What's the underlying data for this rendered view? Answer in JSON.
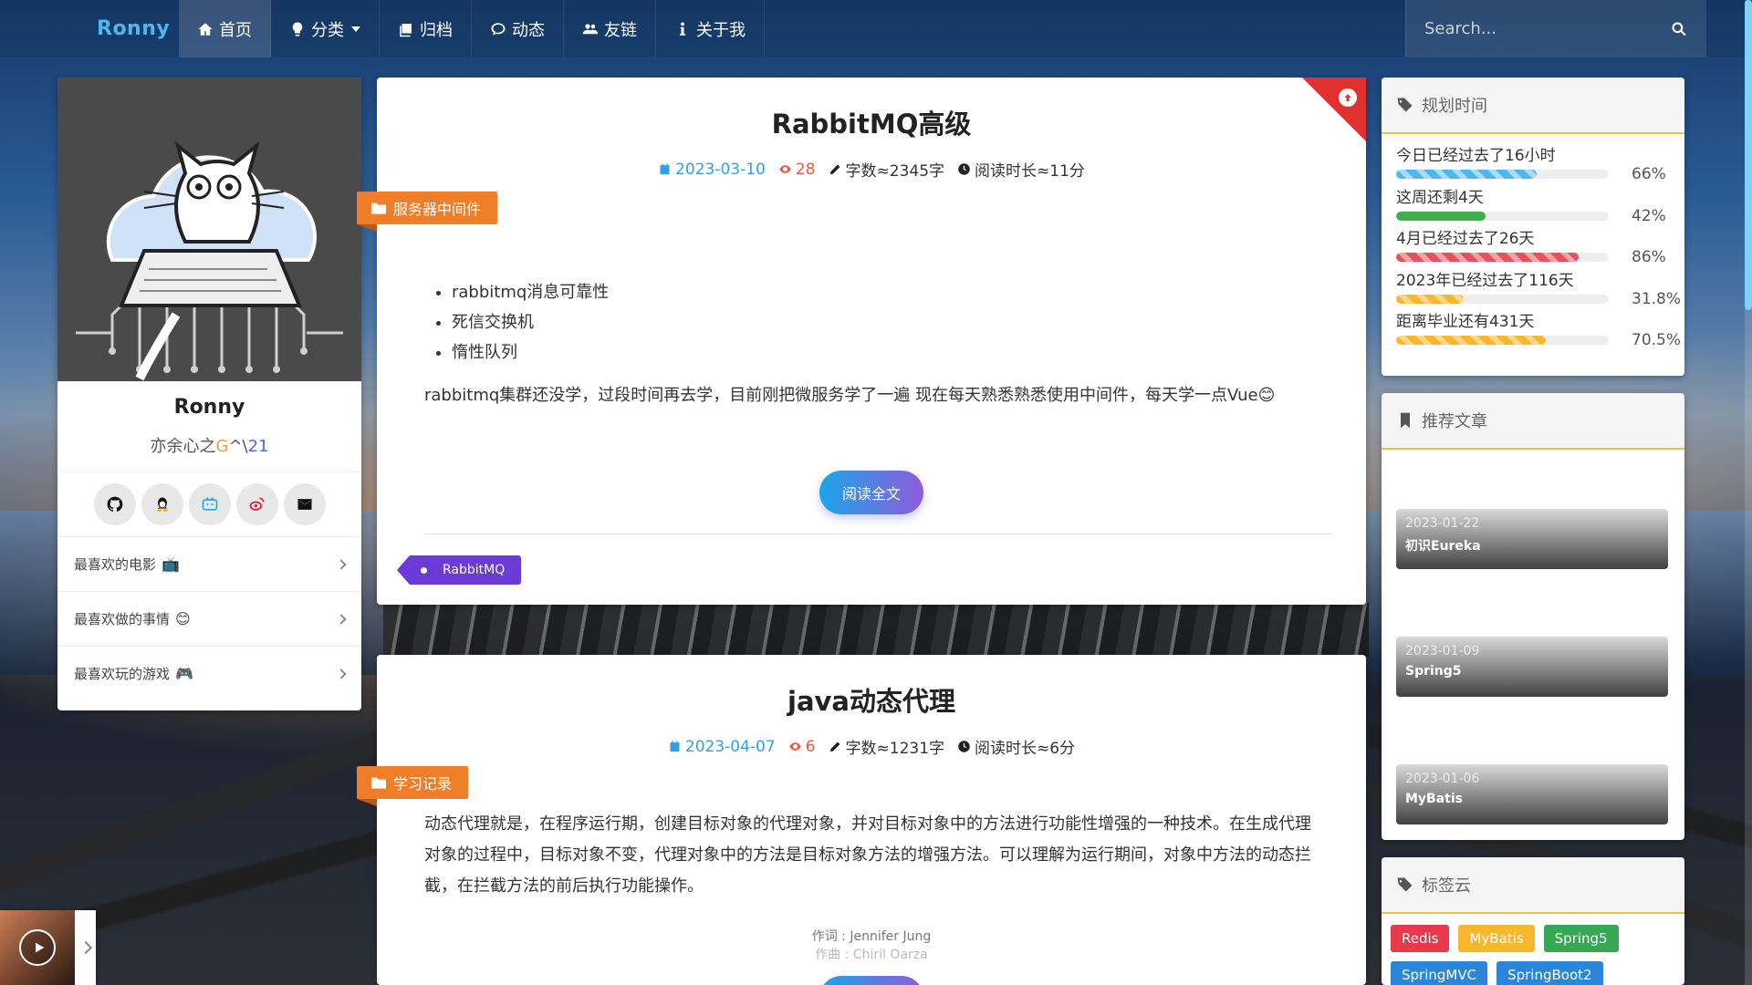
{
  "navbar": {
    "brand": "Ronny",
    "items": [
      {
        "label": "首页",
        "icon": "home-icon",
        "active": true
      },
      {
        "label": "分类",
        "icon": "lightbulb-icon"
      },
      {
        "label": "归档",
        "icon": "archive-icon"
      },
      {
        "label": "动态",
        "icon": "comment-icon"
      },
      {
        "label": "友链",
        "icon": "users-icon"
      },
      {
        "label": "关于我",
        "icon": "info-icon"
      }
    ],
    "search_placeholder": "Search..."
  },
  "profile": {
    "name": "Ronny",
    "motto_prefix": "亦余心之",
    "motto_g": "G",
    "motto_mid": "^\\",
    "motto_num": "21",
    "social": [
      "github-icon",
      "qq-icon",
      "bilibili-icon",
      "weibo-icon",
      "mail-icon"
    ],
    "favorites": [
      {
        "label": "最喜欢的电影",
        "emoji": "📺"
      },
      {
        "label": "最喜欢做的事情",
        "emoji": "😊"
      },
      {
        "label": "最喜欢玩的游戏",
        "emoji": "🎮"
      }
    ]
  },
  "articles": [
    {
      "title": "RabbitMQ高级",
      "date": "2023-03-10",
      "views": "28",
      "words": "字数≈2345字",
      "read_time": "阅读时长≈11分",
      "category": "服务器中间件",
      "list": [
        "rabbitmq消息可靠性",
        "死信交换机",
        "惰性队列"
      ],
      "summary": "rabbitmq集群还没学，过段时间再去学，目前刚把微服务学了一遍 现在每天熟悉熟悉使用中间件，每天学一点Vue😊",
      "read_more": "阅读全文",
      "tag": "RabbitMQ"
    },
    {
      "title": "java动态代理",
      "date": "2023-04-07",
      "views": "6",
      "words": "字数≈1231字",
      "read_time": "阅读时长≈6分",
      "category": "学习记录",
      "summary": "动态代理就是，在程序运行期，创建目标对象的代理对象，并对目标对象中的方法进行功能性增强的一种技术。在生成代理对象的过程中，目标对象不变，代理对象中的方法是目标对象方法的增强方法。可以理解为运行期间，对象中方法的动态拦截，在拦截方法的前后执行功能操作。",
      "lyric_1": "作词 : Jennifer Jung",
      "lyric_2": "作曲 : Chiril Oarza"
    }
  ],
  "time_card": {
    "title": "规划时间",
    "rows": [
      {
        "label": "今日已经过去了16小时",
        "pct_text": "66%",
        "pct": 66,
        "style": "stripe-blue"
      },
      {
        "label": "这周还剩4天",
        "pct_text": "42%",
        "pct": 42,
        "style": "stripe-green"
      },
      {
        "label": "4月已经过去了26天",
        "pct_text": "86%",
        "pct": 86,
        "style": "stripe-red"
      },
      {
        "label": "2023年已经过去了116天",
        "pct_text": "31.8%",
        "pct": 31.8,
        "style": "stripe-yellow"
      },
      {
        "label": "距离毕业还有431天",
        "pct_text": "70.5%",
        "pct": 70.5,
        "style": "stripe-yellow"
      }
    ]
  },
  "recommend": {
    "title": "推荐文章",
    "items": [
      {
        "date": "2023-01-22",
        "title": "初识Eureka"
      },
      {
        "date": "2023-01-09",
        "title": "Spring5"
      },
      {
        "date": "2023-01-06",
        "title": "MyBatis"
      }
    ]
  },
  "tag_cloud": {
    "title": "标签云",
    "tags": [
      {
        "label": "Redis",
        "color": "#e8394a"
      },
      {
        "label": "MyBatis",
        "color": "#f6b72c"
      },
      {
        "label": "Spring5",
        "color": "#34a853"
      },
      {
        "label": "SpringMVC",
        "color": "#2b86d9"
      },
      {
        "label": "SpringBoot2",
        "color": "#2b86d9"
      }
    ]
  }
}
